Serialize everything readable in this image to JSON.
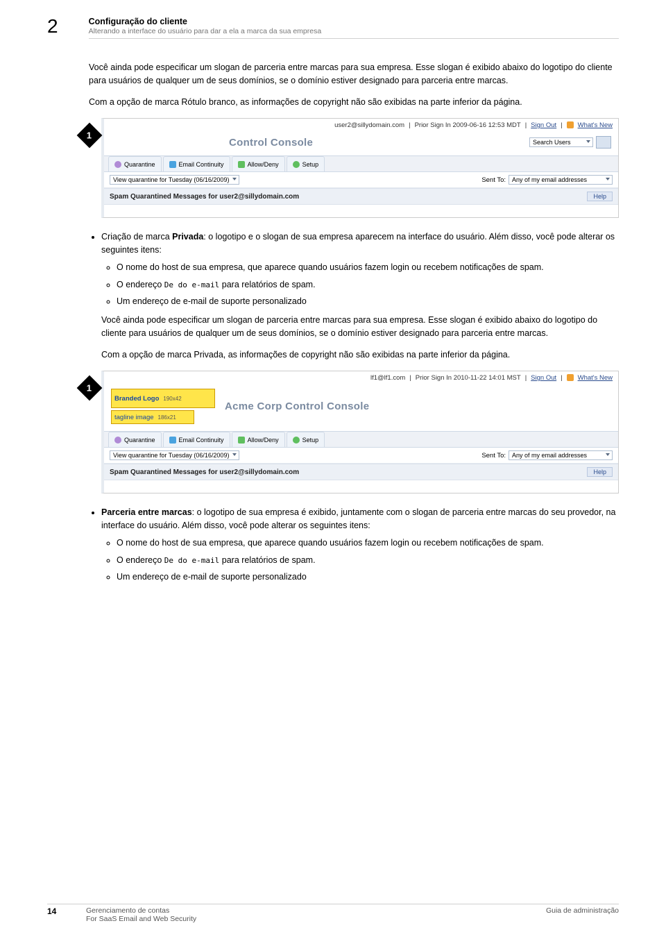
{
  "header": {
    "chapter_number": "2",
    "title": "Configuração do cliente",
    "subtitle": "Alterando a interface do usuário para dar a ela a marca da sua empresa"
  },
  "body": {
    "p1": "Você ainda pode especificar um slogan de parceria entre marcas para sua empresa. Esse slogan é exibido abaixo do logotipo do cliente para usuários de qualquer um de seus domínios, se o domínio estiver designado para parceria entre marcas.",
    "p2": "Com a opção de marca Rótulo branco, as informações de copyright não são exibidas na parte inferior da página.",
    "bullet1_lead_bold": "Privada",
    "bullet1_lead_pre": "Criação de marca ",
    "bullet1_lead_post": ": o logotipo e o slogan de sua empresa aparecem na interface do usuário. Além disso, você pode alterar os seguintes itens:",
    "sub1_a": "O nome do host de sua empresa, que aparece quando usuários fazem login ou recebem notificações de spam.",
    "sub1_b_pre": "O endereço ",
    "sub1_b_mono": "De do e-mail",
    "sub1_b_post": " para relatórios de spam.",
    "sub1_c": "Um endereço de e-mail de suporte personalizado",
    "p3": "Você ainda pode especificar um slogan de parceria entre marcas para sua empresa. Esse slogan é exibido abaixo do logotipo do cliente para usuários de qualquer um de seus domínios, se o domínio estiver designado para parceria entre marcas.",
    "p4": "Com a opção de marca Privada, as informações de copyright não são exibidas na parte inferior da página.",
    "bullet2_lead_bold": "Parceria entre marcas",
    "bullet2_lead_post": ": o logotipo de sua empresa é exibido, juntamente com o slogan de parceria entre marcas do seu provedor, na interface do usuário. Além disso, você pode alterar os seguintes itens:",
    "sub2_a": "O nome do host de sua empresa, que aparece quando usuários fazem login ou recebem notificações de spam.",
    "sub2_b_pre": "O endereço ",
    "sub2_b_mono": "De do e-mail",
    "sub2_b_post": " para relatórios de spam.",
    "sub2_c": "Um endereço de e-mail de suporte personalizado"
  },
  "screenshot1": {
    "callout": "1",
    "top_user": "user2@sillydomain.com",
    "top_prior": "Prior Sign In 2009-06-16 12:53 MDT",
    "top_signout": "Sign Out",
    "top_whatsnew": "What's New",
    "title": "Control Console",
    "search_dd": "Search Users",
    "tabs": {
      "q": "Quarantine",
      "e": "Email Continuity",
      "a": "Allow/Deny",
      "s": "Setup"
    },
    "quarantine_dd": "View quarantine for Tuesday (06/16/2009)",
    "sent_to_label": "Sent To:",
    "sent_to_dd": "Any of my email addresses",
    "spam_title": "Spam Quarantined Messages for user2@sillydomain.com",
    "help": "Help"
  },
  "screenshot2": {
    "callout": "1",
    "top_user": "lf1@lf1.com",
    "top_prior": "Prior Sign In 2010-11-22 14:01 MST",
    "top_signout": "Sign Out",
    "top_whatsnew": "What's New",
    "logo_text": "Branded Logo",
    "logo_dim": "190x42",
    "tagline_text": "tagline image",
    "tagline_dim": "186x21",
    "title": "Acme Corp Control Console",
    "tabs": {
      "q": "Quarantine",
      "e": "Email Continuity",
      "a": "Allow/Deny",
      "s": "Setup"
    },
    "quarantine_dd": "View quarantine for Tuesday (06/16/2009)",
    "sent_to_label": "Sent To:",
    "sent_to_dd": "Any of my email addresses",
    "spam_title": "Spam Quarantined Messages for user2@sillydomain.com",
    "help": "Help"
  },
  "footer": {
    "page_number": "14",
    "left1": "Gerenciamento de contas",
    "left2": "For SaaS Email and Web Security",
    "right": "Guia de administração"
  }
}
